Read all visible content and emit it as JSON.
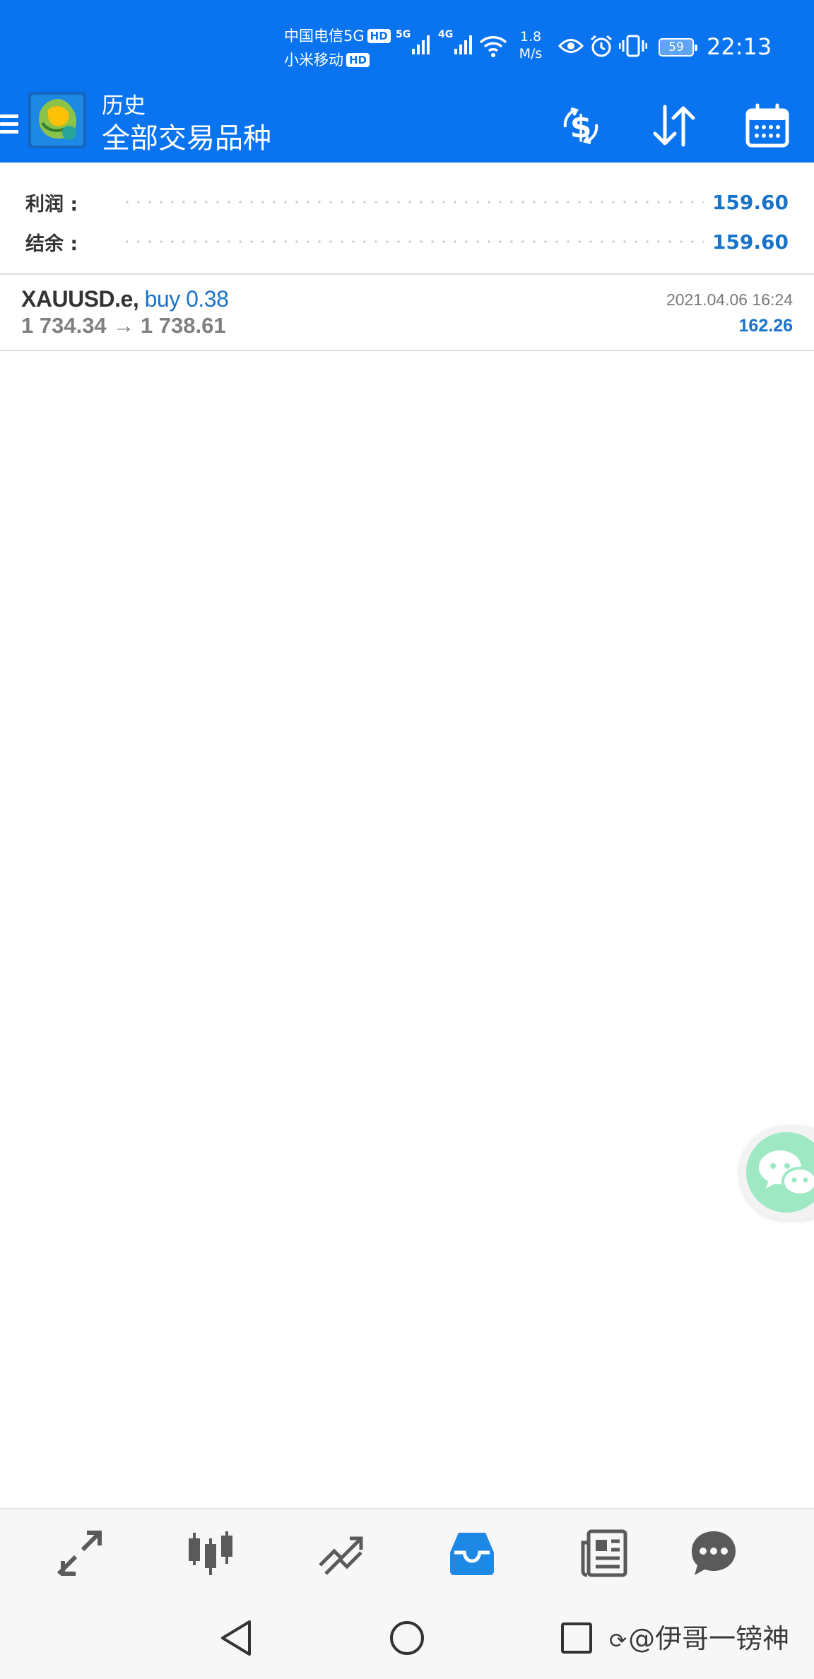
{
  "status_bar": {
    "carrier_1": "中国电信5G",
    "carrier_1_badge": "HD",
    "carrier_2": "小米移动",
    "carrier_2_badge": "HD",
    "signal_1_label": "5G",
    "signal_2_label": "4G",
    "network_speed_value": "1.8",
    "network_speed_unit": "M/s",
    "battery": "59",
    "time": "22:13"
  },
  "header": {
    "subtitle": "历史",
    "title": "全部交易品种",
    "icons": [
      "menu-icon",
      "metatrader-logo",
      "dollar-exchange-icon",
      "sort-icon",
      "calendar-icon"
    ]
  },
  "summary": {
    "profit_label": "利润 :",
    "profit_value": "159.60",
    "balance_label": "结余 :",
    "balance_value": "159.60"
  },
  "deals": [
    {
      "symbol": "XAUUSD.e,",
      "type": "buy 0.38",
      "prices": "1 734.34 → 1 738.61",
      "time": "2021.04.06 16:24",
      "profit": "162.26"
    }
  ],
  "bottom_nav": {
    "items": [
      "quotes-icon",
      "chart-icon",
      "trade-icon",
      "history-icon",
      "news-icon",
      "chat-icon"
    ],
    "active": "history-icon",
    "active_color": "#1e88e5",
    "inactive_color": "#5a5a5a"
  },
  "watermark": {
    "text": "@伊哥一镑神"
  },
  "colors": {
    "primary": "#0a74f0",
    "value_blue": "#1a73c8",
    "chat_bubble": "#9ee8c4"
  }
}
